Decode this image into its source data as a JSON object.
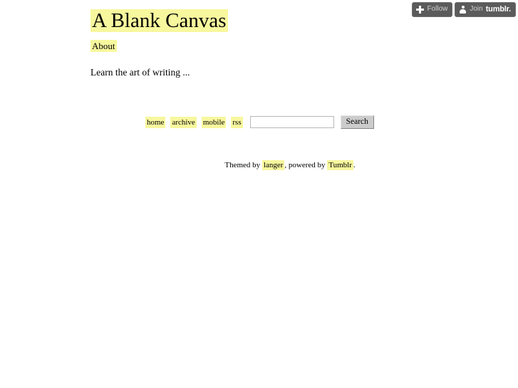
{
  "colors": {
    "highlight": "#f7f79e",
    "page_background": "#ffffff",
    "text": "#000000",
    "tumblr_button_bg": "#5b5b5b",
    "button_gray": "#cccccc"
  },
  "tumblr_bar": {
    "follow": {
      "icon": "plus-icon",
      "label": "Follow"
    },
    "join": {
      "icon": "person-icon",
      "label": "Join",
      "brand": "tumblr."
    }
  },
  "header": {
    "site_title": "A Blank Canvas",
    "pages": [
      {
        "label": "About"
      }
    ]
  },
  "main": {
    "description": "Learn the art of writing ..."
  },
  "nav": {
    "links": [
      {
        "label": "home"
      },
      {
        "label": "archive"
      },
      {
        "label": "mobile"
      },
      {
        "label": "rss"
      }
    ],
    "search": {
      "value": "",
      "placeholder": "",
      "button_label": "Search"
    }
  },
  "footer": {
    "prefix": "Themed by ",
    "theme_author": "langer",
    "middle": ", powered by ",
    "platform": "Tumblr",
    "suffix": "."
  }
}
